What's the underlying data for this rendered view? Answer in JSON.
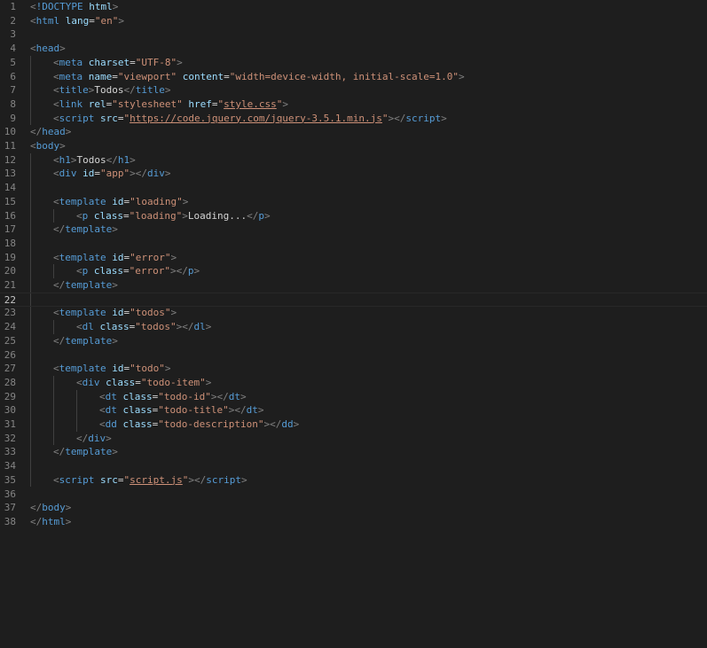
{
  "editor": {
    "theme_colors": {
      "background": "#1e1e1e",
      "line_number": "#858585",
      "tag": "#569cd6",
      "punctuation": "#808080",
      "attribute": "#9cdcfe",
      "string": "#ce9178",
      "text": "#d4d4d4"
    },
    "current_line": 22,
    "lines": [
      {
        "n": 1,
        "indent": 0,
        "tokens": [
          [
            "p",
            "<"
          ],
          [
            "d",
            "!DOCTYPE"
          ],
          [
            "x",
            " "
          ],
          [
            "a",
            "html"
          ],
          [
            "p",
            ">"
          ]
        ]
      },
      {
        "n": 2,
        "indent": 0,
        "tokens": [
          [
            "p",
            "<"
          ],
          [
            "t",
            "html"
          ],
          [
            "x",
            " "
          ],
          [
            "a",
            "lang"
          ],
          [
            "e",
            "="
          ],
          [
            "s",
            "\"en\""
          ],
          [
            "p",
            ">"
          ]
        ]
      },
      {
        "n": 3,
        "indent": 0,
        "tokens": []
      },
      {
        "n": 4,
        "indent": 0,
        "tokens": [
          [
            "p",
            "<"
          ],
          [
            "t",
            "head"
          ],
          [
            "p",
            ">"
          ]
        ]
      },
      {
        "n": 5,
        "indent": 1,
        "tokens": [
          [
            "p",
            "<"
          ],
          [
            "t",
            "meta"
          ],
          [
            "x",
            " "
          ],
          [
            "a",
            "charset"
          ],
          [
            "e",
            "="
          ],
          [
            "s",
            "\"UTF-8\""
          ],
          [
            "p",
            ">"
          ]
        ]
      },
      {
        "n": 6,
        "indent": 1,
        "tokens": [
          [
            "p",
            "<"
          ],
          [
            "t",
            "meta"
          ],
          [
            "x",
            " "
          ],
          [
            "a",
            "name"
          ],
          [
            "e",
            "="
          ],
          [
            "s",
            "\"viewport\""
          ],
          [
            "x",
            " "
          ],
          [
            "a",
            "content"
          ],
          [
            "e",
            "="
          ],
          [
            "s",
            "\"width=device-width, initial-scale=1.0\""
          ],
          [
            "p",
            ">"
          ]
        ]
      },
      {
        "n": 7,
        "indent": 1,
        "tokens": [
          [
            "p",
            "<"
          ],
          [
            "t",
            "title"
          ],
          [
            "p",
            ">"
          ],
          [
            "x",
            "Todos"
          ],
          [
            "p",
            "</"
          ],
          [
            "t",
            "title"
          ],
          [
            "p",
            ">"
          ]
        ]
      },
      {
        "n": 8,
        "indent": 1,
        "tokens": [
          [
            "p",
            "<"
          ],
          [
            "t",
            "link"
          ],
          [
            "x",
            " "
          ],
          [
            "a",
            "rel"
          ],
          [
            "e",
            "="
          ],
          [
            "s",
            "\"stylesheet\""
          ],
          [
            "x",
            " "
          ],
          [
            "a",
            "href"
          ],
          [
            "e",
            "="
          ],
          [
            "s",
            "\""
          ],
          [
            "sl",
            "style.css"
          ],
          [
            "s",
            "\""
          ],
          [
            "p",
            ">"
          ]
        ]
      },
      {
        "n": 9,
        "indent": 1,
        "tokens": [
          [
            "p",
            "<"
          ],
          [
            "t",
            "script"
          ],
          [
            "x",
            " "
          ],
          [
            "a",
            "src"
          ],
          [
            "e",
            "="
          ],
          [
            "s",
            "\""
          ],
          [
            "sl",
            "https://code.jquery.com/jquery-3.5.1.min.js"
          ],
          [
            "s",
            "\""
          ],
          [
            "p",
            "></"
          ],
          [
            "t",
            "script"
          ],
          [
            "p",
            ">"
          ]
        ]
      },
      {
        "n": 10,
        "indent": 0,
        "tokens": [
          [
            "p",
            "</"
          ],
          [
            "t",
            "head"
          ],
          [
            "p",
            ">"
          ]
        ]
      },
      {
        "n": 11,
        "indent": 0,
        "tokens": [
          [
            "p",
            "<"
          ],
          [
            "t",
            "body"
          ],
          [
            "p",
            ">"
          ]
        ]
      },
      {
        "n": 12,
        "indent": 1,
        "tokens": [
          [
            "p",
            "<"
          ],
          [
            "t",
            "h1"
          ],
          [
            "p",
            ">"
          ],
          [
            "x",
            "Todos"
          ],
          [
            "p",
            "</"
          ],
          [
            "t",
            "h1"
          ],
          [
            "p",
            ">"
          ]
        ]
      },
      {
        "n": 13,
        "indent": 1,
        "tokens": [
          [
            "p",
            "<"
          ],
          [
            "t",
            "div"
          ],
          [
            "x",
            " "
          ],
          [
            "a",
            "id"
          ],
          [
            "e",
            "="
          ],
          [
            "s",
            "\"app\""
          ],
          [
            "p",
            "></"
          ],
          [
            "t",
            "div"
          ],
          [
            "p",
            ">"
          ]
        ]
      },
      {
        "n": 14,
        "indent": 0,
        "tokens": []
      },
      {
        "n": 15,
        "indent": 1,
        "tokens": [
          [
            "p",
            "<"
          ],
          [
            "t",
            "template"
          ],
          [
            "x",
            " "
          ],
          [
            "a",
            "id"
          ],
          [
            "e",
            "="
          ],
          [
            "s",
            "\"loading\""
          ],
          [
            "p",
            ">"
          ]
        ]
      },
      {
        "n": 16,
        "indent": 2,
        "tokens": [
          [
            "p",
            "<"
          ],
          [
            "t",
            "p"
          ],
          [
            "x",
            " "
          ],
          [
            "a",
            "class"
          ],
          [
            "e",
            "="
          ],
          [
            "s",
            "\"loading\""
          ],
          [
            "p",
            ">"
          ],
          [
            "x",
            "Loading..."
          ],
          [
            "p",
            "</"
          ],
          [
            "t",
            "p"
          ],
          [
            "p",
            ">"
          ]
        ]
      },
      {
        "n": 17,
        "indent": 1,
        "tokens": [
          [
            "p",
            "</"
          ],
          [
            "t",
            "template"
          ],
          [
            "p",
            ">"
          ]
        ]
      },
      {
        "n": 18,
        "indent": 0,
        "tokens": []
      },
      {
        "n": 19,
        "indent": 1,
        "tokens": [
          [
            "p",
            "<"
          ],
          [
            "t",
            "template"
          ],
          [
            "x",
            " "
          ],
          [
            "a",
            "id"
          ],
          [
            "e",
            "="
          ],
          [
            "s",
            "\"error\""
          ],
          [
            "p",
            ">"
          ]
        ]
      },
      {
        "n": 20,
        "indent": 2,
        "tokens": [
          [
            "p",
            "<"
          ],
          [
            "t",
            "p"
          ],
          [
            "x",
            " "
          ],
          [
            "a",
            "class"
          ],
          [
            "e",
            "="
          ],
          [
            "s",
            "\"error\""
          ],
          [
            "p",
            "></"
          ],
          [
            "t",
            "p"
          ],
          [
            "p",
            ">"
          ]
        ]
      },
      {
        "n": 21,
        "indent": 1,
        "tokens": [
          [
            "p",
            "</"
          ],
          [
            "t",
            "template"
          ],
          [
            "p",
            ">"
          ]
        ]
      },
      {
        "n": 22,
        "indent": 0,
        "tokens": []
      },
      {
        "n": 23,
        "indent": 1,
        "tokens": [
          [
            "p",
            "<"
          ],
          [
            "t",
            "template"
          ],
          [
            "x",
            " "
          ],
          [
            "a",
            "id"
          ],
          [
            "e",
            "="
          ],
          [
            "s",
            "\"todos\""
          ],
          [
            "p",
            ">"
          ]
        ]
      },
      {
        "n": 24,
        "indent": 2,
        "tokens": [
          [
            "p",
            "<"
          ],
          [
            "t",
            "dl"
          ],
          [
            "x",
            " "
          ],
          [
            "a",
            "class"
          ],
          [
            "e",
            "="
          ],
          [
            "s",
            "\"todos\""
          ],
          [
            "p",
            "></"
          ],
          [
            "t",
            "dl"
          ],
          [
            "p",
            ">"
          ]
        ]
      },
      {
        "n": 25,
        "indent": 1,
        "tokens": [
          [
            "p",
            "</"
          ],
          [
            "t",
            "template"
          ],
          [
            "p",
            ">"
          ]
        ]
      },
      {
        "n": 26,
        "indent": 0,
        "tokens": []
      },
      {
        "n": 27,
        "indent": 1,
        "tokens": [
          [
            "p",
            "<"
          ],
          [
            "t",
            "template"
          ],
          [
            "x",
            " "
          ],
          [
            "a",
            "id"
          ],
          [
            "e",
            "="
          ],
          [
            "s",
            "\"todo\""
          ],
          [
            "p",
            ">"
          ]
        ]
      },
      {
        "n": 28,
        "indent": 2,
        "tokens": [
          [
            "p",
            "<"
          ],
          [
            "t",
            "div"
          ],
          [
            "x",
            " "
          ],
          [
            "a",
            "class"
          ],
          [
            "e",
            "="
          ],
          [
            "s",
            "\"todo-item\""
          ],
          [
            "p",
            ">"
          ]
        ]
      },
      {
        "n": 29,
        "indent": 3,
        "tokens": [
          [
            "p",
            "<"
          ],
          [
            "t",
            "dt"
          ],
          [
            "x",
            " "
          ],
          [
            "a",
            "class"
          ],
          [
            "e",
            "="
          ],
          [
            "s",
            "\"todo-id\""
          ],
          [
            "p",
            "></"
          ],
          [
            "t",
            "dt"
          ],
          [
            "p",
            ">"
          ]
        ]
      },
      {
        "n": 30,
        "indent": 3,
        "tokens": [
          [
            "p",
            "<"
          ],
          [
            "t",
            "dt"
          ],
          [
            "x",
            " "
          ],
          [
            "a",
            "class"
          ],
          [
            "e",
            "="
          ],
          [
            "s",
            "\"todo-title\""
          ],
          [
            "p",
            "></"
          ],
          [
            "t",
            "dt"
          ],
          [
            "p",
            ">"
          ]
        ]
      },
      {
        "n": 31,
        "indent": 3,
        "tokens": [
          [
            "p",
            "<"
          ],
          [
            "t",
            "dd"
          ],
          [
            "x",
            " "
          ],
          [
            "a",
            "class"
          ],
          [
            "e",
            "="
          ],
          [
            "s",
            "\"todo-description\""
          ],
          [
            "p",
            "></"
          ],
          [
            "t",
            "dd"
          ],
          [
            "p",
            ">"
          ]
        ]
      },
      {
        "n": 32,
        "indent": 2,
        "tokens": [
          [
            "p",
            "</"
          ],
          [
            "t",
            "div"
          ],
          [
            "p",
            ">"
          ]
        ]
      },
      {
        "n": 33,
        "indent": 1,
        "tokens": [
          [
            "p",
            "</"
          ],
          [
            "t",
            "template"
          ],
          [
            "p",
            ">"
          ]
        ]
      },
      {
        "n": 34,
        "indent": 0,
        "tokens": []
      },
      {
        "n": 35,
        "indent": 1,
        "tokens": [
          [
            "p",
            "<"
          ],
          [
            "t",
            "script"
          ],
          [
            "x",
            " "
          ],
          [
            "a",
            "src"
          ],
          [
            "e",
            "="
          ],
          [
            "s",
            "\""
          ],
          [
            "sl",
            "script.js"
          ],
          [
            "s",
            "\""
          ],
          [
            "p",
            "></"
          ],
          [
            "t",
            "script"
          ],
          [
            "p",
            ">"
          ]
        ]
      },
      {
        "n": 36,
        "indent": 0,
        "tokens": []
      },
      {
        "n": 37,
        "indent": 0,
        "tokens": [
          [
            "p",
            "</"
          ],
          [
            "t",
            "body"
          ],
          [
            "p",
            ">"
          ]
        ]
      },
      {
        "n": 38,
        "indent": 0,
        "tokens": [
          [
            "p",
            "</"
          ],
          [
            "t",
            "html"
          ],
          [
            "p",
            ">"
          ]
        ]
      }
    ]
  }
}
